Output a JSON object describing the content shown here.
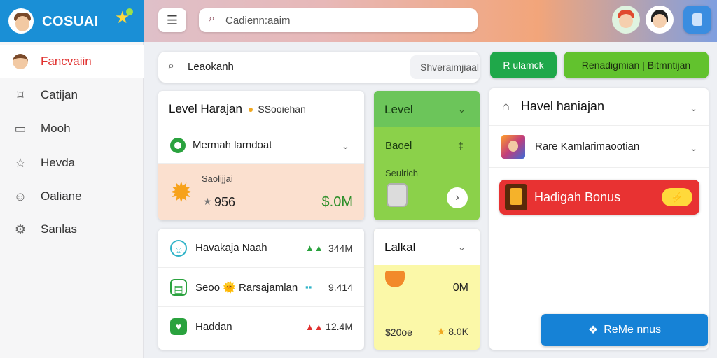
{
  "brand": {
    "name": "COSUAI",
    "badge_icon": "star-icon"
  },
  "topbar": {
    "menu_icon": "menu-icon",
    "search": {
      "placeholder": "",
      "value": "Cadienn:aaim"
    }
  },
  "sidebar": {
    "items": [
      {
        "label": "Fancvaiin",
        "icon": "avatar-icon",
        "active": true
      },
      {
        "label": "Catijan",
        "icon": "bookmark-icon"
      },
      {
        "label": "Mooh",
        "icon": "image-icon"
      },
      {
        "label": "Hevda",
        "icon": "star-outline-icon"
      },
      {
        "label": "Oaliane",
        "icon": "smile-icon"
      },
      {
        "label": "Sanlas",
        "icon": "gear-icon"
      }
    ]
  },
  "filter": {
    "label": "Leaokanh",
    "select_value": "Shveraimjiaal",
    "clear_glyph": "✕",
    "dropdown_glyph": "⌄"
  },
  "buttons": {
    "primary": "R ulamck",
    "secondary": "Renadigmian |   Bitmntijan"
  },
  "level_card": {
    "title": "Level Harajan",
    "title_sub": "SSooiehan",
    "row_label": "Mermah larndoat",
    "caption": "Saolijjai",
    "score": "956",
    "money": "$.0M"
  },
  "green_card": {
    "title": "Level",
    "line1": "Baoel",
    "hash": "‡",
    "line2": "Seulrich",
    "go_glyph": "›"
  },
  "list_card": {
    "rows": [
      {
        "label": "Havakaja Naah",
        "value": "344M",
        "icon": "smile-icon"
      },
      {
        "label": "Seoo 🌞 Rarsajamlan",
        "value": "9.414",
        "icon": "calendar-icon"
      },
      {
        "label": "Haddan",
        "value": "12.4M",
        "icon": "heart-icon"
      }
    ]
  },
  "yellow_card": {
    "title": "Lalkal",
    "value_1": "0M",
    "value_2": "$20oe",
    "value_3": "8.0K"
  },
  "right_panel": {
    "title": "Havel haniajan",
    "sub_label": "Rare Kamlarimaootian",
    "bonus_label": "Hadigah Bonus",
    "bonus_pill": "⚡"
  },
  "cta": {
    "label": "ReMe nnus",
    "icon": "gift-icon"
  },
  "colors": {
    "brand_blue": "#1a8fd6",
    "active_red": "#e0302e",
    "green_primary": "#1fa84a",
    "green_secondary": "#62c22e",
    "bonus_red": "#e83232",
    "cta_blue": "#1682d6"
  }
}
